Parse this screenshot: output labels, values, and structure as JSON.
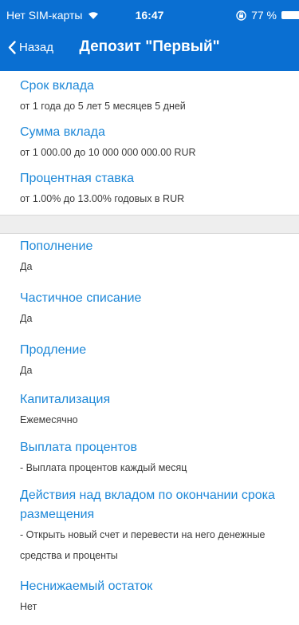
{
  "status_bar": {
    "carrier": "Нет SIM-карты",
    "time": "16:47",
    "battery": "77 %"
  },
  "nav": {
    "back_label": "Назад",
    "title": "Депозит \"Первый\""
  },
  "conditions": [
    {
      "label": "Срок вклада",
      "value": "от 1 года до 5 лет 5 месяцев 5 дней"
    },
    {
      "label": "Сумма вклада",
      "value": "от 1 000.00 до 10 000 000 000.00 RUR"
    },
    {
      "label": "Процентная ставка",
      "value": "от 1.00% до 13.00% годовых в RUR"
    }
  ],
  "options": [
    {
      "label": "Пополнение",
      "value": "Да"
    },
    {
      "label": "Частичное списание",
      "value": "Да"
    },
    {
      "label": "Продление",
      "value": "Да"
    },
    {
      "label": "Капитализация",
      "value": "Ежемесячно"
    },
    {
      "label": "Выплата процентов",
      "value": "- Выплата процентов каждый месяц"
    },
    {
      "label": "Действия над вкладом по окончании срока размещения",
      "value": "- Открыть новый счет и перевести на него денежные средства и проценты"
    },
    {
      "label": "Неснижаемый остаток",
      "value": "Нет"
    }
  ],
  "colors": {
    "header_bg": "#0a6fd2",
    "label_blue": "#1e88d8",
    "divider": "#eeeeee"
  }
}
